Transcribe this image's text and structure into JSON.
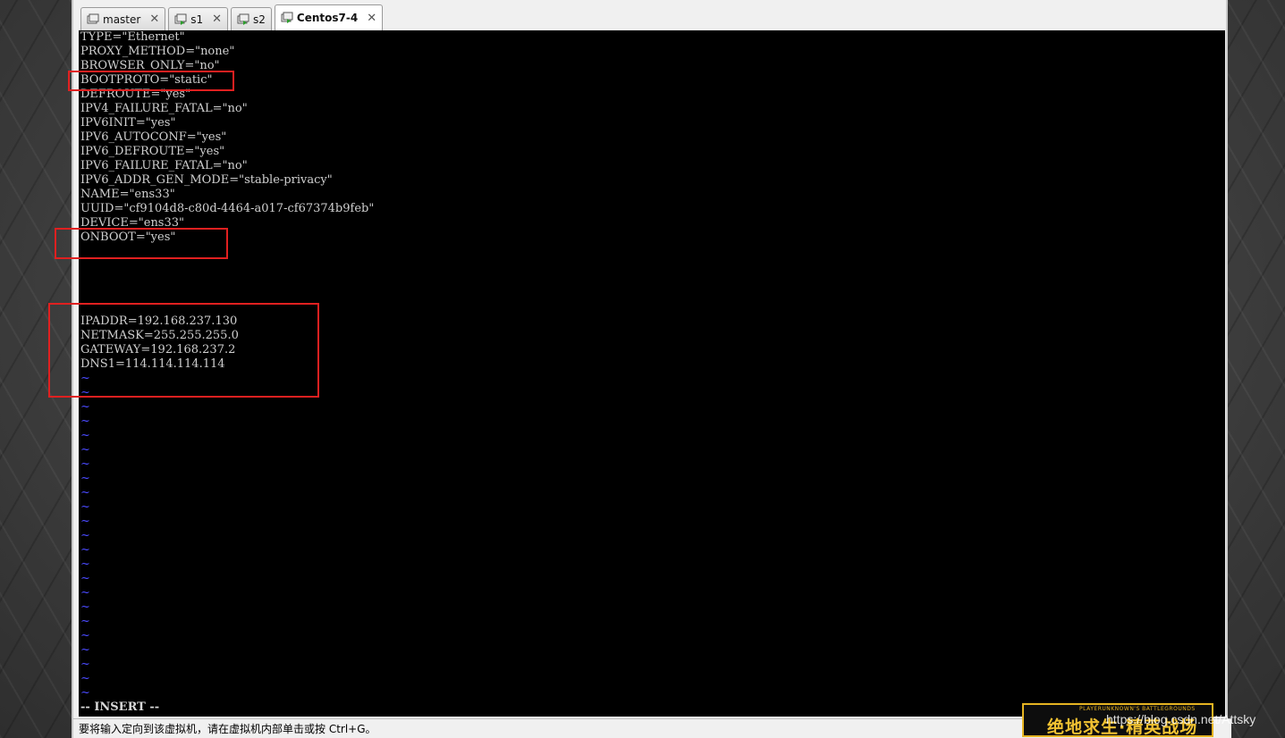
{
  "tabs": [
    {
      "label": "master",
      "active": false,
      "icon": "vm-icon"
    },
    {
      "label": "s1",
      "active": false,
      "icon": "vm-running-icon"
    },
    {
      "label": "s2",
      "active": false,
      "icon": "vm-running-icon"
    },
    {
      "label": "Centos7-4",
      "active": true,
      "icon": "vm-running-icon"
    }
  ],
  "config_lines": [
    "TYPE=\"Ethernet\"",
    "PROXY_METHOD=\"none\"",
    "BROWSER_ONLY=\"no\"",
    "BOOTPROTO=\"static\"",
    "DEFROUTE=\"yes\"",
    "IPV4_FAILURE_FATAL=\"no\"",
    "IPV6INIT=\"yes\"",
    "IPV6_AUTOCONF=\"yes\"",
    "IPV6_DEFROUTE=\"yes\"",
    "IPV6_FAILURE_FATAL=\"no\"",
    "IPV6_ADDR_GEN_MODE=\"stable-privacy\"",
    "NAME=\"ens33\"",
    "UUID=\"cf9104d8-c80d-4464-a017-cf67374b9feb\"",
    "DEVICE=\"ens33\"",
    "ONBOOT=\"yes\""
  ],
  "network_lines": [
    "IPADDR=192.168.237.130",
    "NETMASK=255.255.255.0",
    "GATEWAY=192.168.237.2",
    "DNS1=114.114.114.114"
  ],
  "tilde_char": "~",
  "vim_mode": "-- INSERT --",
  "statusbar_text": "要将输入定向到该虚拟机，请在虚拟机内部单击或按 Ctrl+G。",
  "watermark": {
    "logo_small": "PLAYERUNKNOWN'S BATTLEGROUNDS",
    "logo_big": "绝地求生·精英战场",
    "url": "https://blog.csdn.net/Attsky"
  },
  "colors": {
    "console_bg": "#000000",
    "console_text": "#d0d0d0",
    "tilde": "#4a4aff",
    "highlight_box": "#e02020"
  }
}
